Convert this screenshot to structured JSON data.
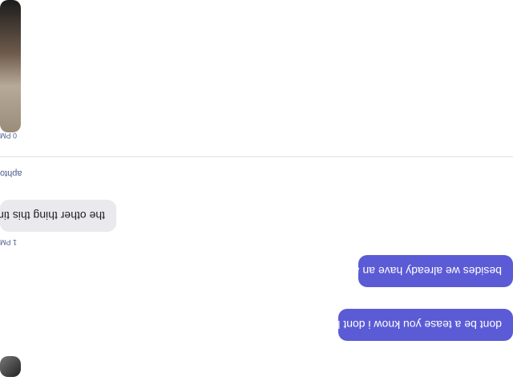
{
  "messages": [
    {
      "side": "outgoing",
      "text": "dont be a tease you know i dont li"
    },
    {
      "side": "outgoing",
      "text": "besides we already have an agre"
    },
    {
      "side": "incoming",
      "text": "the other thing this time"
    },
    {
      "side": "incoming",
      "text": "1 PM"
    }
  ],
  "divider_label": "aphto",
  "photo_time": "0 PM",
  "colors": {
    "outgoing_bubble": "#5b5bd6",
    "incoming_bubble": "#e9e9ee",
    "meta_text": "#4c5a8a"
  }
}
